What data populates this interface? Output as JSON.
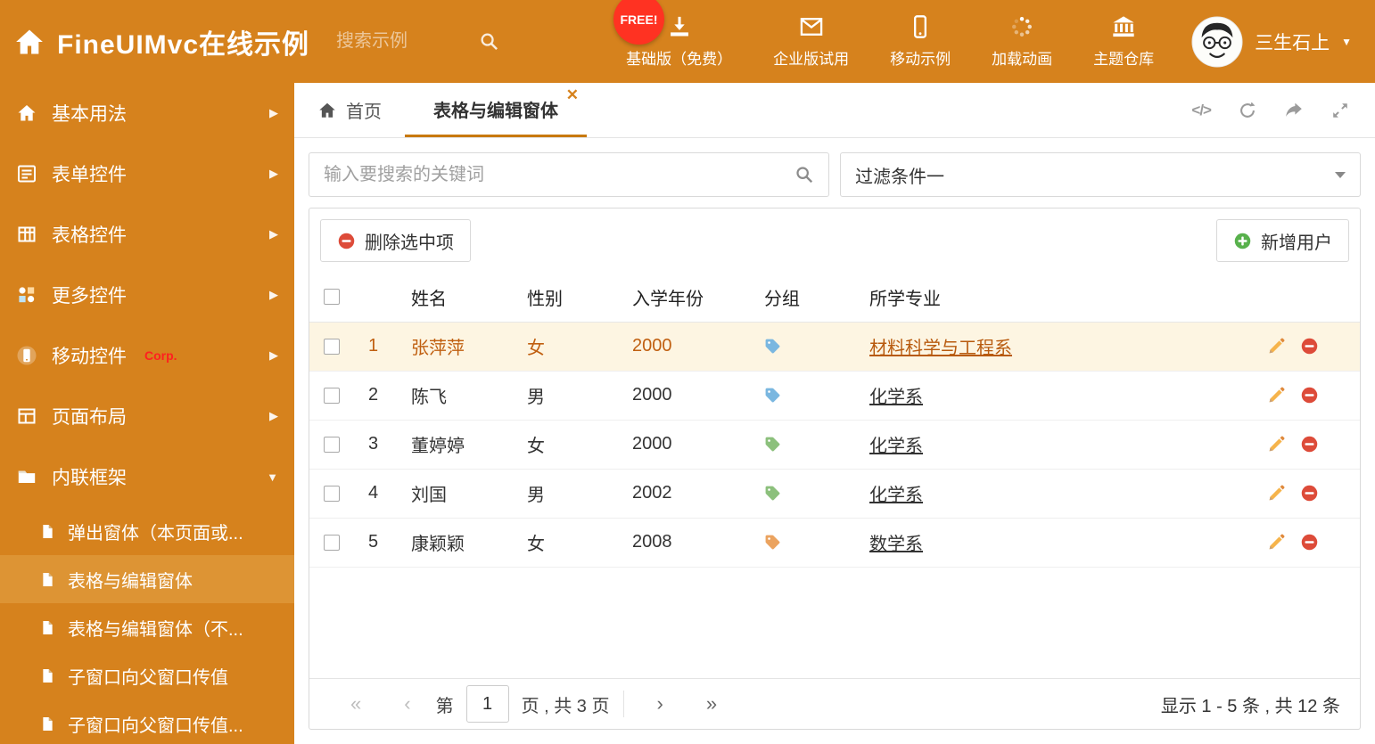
{
  "colors": {
    "theme_orange": "#d6821d",
    "sidebar_selected": "#dd9434",
    "tab_underline": "#c8790e",
    "free_badge_red": "#ff3222",
    "selected_row_bg": "#fdf5e2",
    "selected_row_text": "#c05f10",
    "delete_red": "#dd4b39",
    "add_green": "#58b14c"
  },
  "header": {
    "title": "FineUIMvc在线示例",
    "search_placeholder": "搜索示例",
    "free_badge": "FREE!",
    "nav": [
      {
        "label": "基础版（免费）",
        "icon": "download-icon"
      },
      {
        "label": "企业版试用",
        "icon": "mail-icon"
      },
      {
        "label": "移动示例",
        "icon": "mobile-icon"
      },
      {
        "label": "加载动画",
        "icon": "spinner-icon"
      },
      {
        "label": "主题仓库",
        "icon": "bank-icon"
      }
    ],
    "user_name": "三生石上"
  },
  "sidebar": {
    "items": [
      {
        "label": "基本用法"
      },
      {
        "label": "表单控件"
      },
      {
        "label": "表格控件"
      },
      {
        "label": "更多控件"
      },
      {
        "label": "移动控件",
        "badge": "Corp."
      },
      {
        "label": "页面布局"
      },
      {
        "label": "内联框架"
      }
    ],
    "subitems": [
      {
        "label": "弹出窗体（本页面或..."
      },
      {
        "label": "表格与编辑窗体"
      },
      {
        "label": "表格与编辑窗体（不..."
      },
      {
        "label": "子窗口向父窗口传值"
      },
      {
        "label": "子窗口向父窗口传值..."
      }
    ]
  },
  "tabbar": {
    "home_tab": "首页",
    "active_tab": "表格与编辑窗体"
  },
  "filter_row": {
    "search_placeholder": "输入要搜索的关键词",
    "filter_selected": "过滤条件一"
  },
  "toolbar": {
    "delete_button": "删除选中项",
    "add_button": "新增用户"
  },
  "grid": {
    "headers": {
      "name": "姓名",
      "gender": "性别",
      "year": "入学年份",
      "group": "分组",
      "major": "所学专业"
    },
    "rows": [
      {
        "no": "1",
        "name": "张萍萍",
        "gender": "女",
        "year": "2000",
        "tag_color": "#7ab7e0",
        "major": "材料科学与工程系"
      },
      {
        "no": "2",
        "name": "陈飞",
        "gender": "男",
        "year": "2000",
        "tag_color": "#7ab7e0",
        "major": "化学系"
      },
      {
        "no": "3",
        "name": "董婷婷",
        "gender": "女",
        "year": "2000",
        "tag_color": "#8cc07c",
        "major": "化学系"
      },
      {
        "no": "4",
        "name": "刘国",
        "gender": "男",
        "year": "2002",
        "tag_color": "#8cc07c",
        "major": "化学系"
      },
      {
        "no": "5",
        "name": "康颖颖",
        "gender": "女",
        "year": "2008",
        "tag_color": "#eba35f",
        "major": "数学系"
      }
    ]
  },
  "pagination": {
    "label_page": "第",
    "page_input": "1",
    "label_total": "页 , 共 3 页",
    "summary": "显示 1 - 5 条 , 共 12 条"
  }
}
